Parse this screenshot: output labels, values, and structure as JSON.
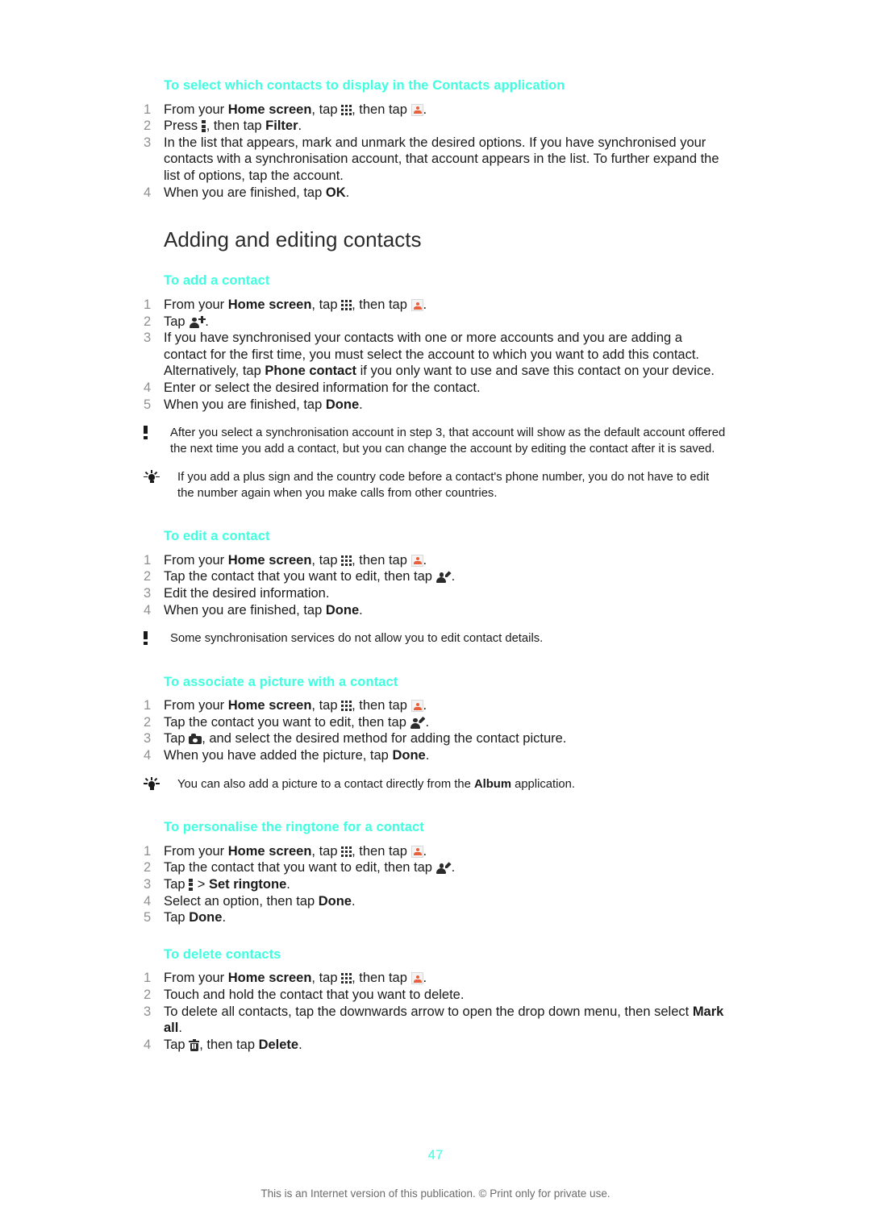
{
  "page": {
    "number": "47",
    "footer_note": "This is an Internet version of this publication. © Print only for private use.",
    "heading_color": "#3fffe0",
    "body_color": "#1a1a1a",
    "step_number_color": "#8f8f8f"
  },
  "proc_filter": {
    "title": "To select which contacts to display in the Contacts application",
    "steps": {
      "s1_a": "From your ",
      "s1_home": "Home screen",
      "s1_b": ", tap ",
      "s1_c": ", then tap ",
      "s1_d": ".",
      "s2_a": "Press ",
      "s2_b": ", then tap ",
      "s2_filter": "Filter",
      "s2_c": ".",
      "s3": "In the list that appears, mark and unmark the desired options. If you have synchronised your contacts with a synchronisation account, that account appears in the list. To further expand the list of options, tap the account.",
      "s4_a": "When you are finished, tap ",
      "s4_ok": "OK",
      "s4_b": "."
    }
  },
  "section": {
    "title": "Adding and editing contacts"
  },
  "proc_add": {
    "title": "To add a contact",
    "steps": {
      "s1_a": "From your ",
      "s1_home": "Home screen",
      "s1_b": ", tap ",
      "s1_c": ", then tap ",
      "s1_d": ".",
      "s2_a": "Tap ",
      "s2_b": ".",
      "s3_a": "If you have synchronised your contacts with one or more accounts and you are adding a contact for the first time, you must select the account to which you want to add this contact. Alternatively, tap ",
      "s3_phone": "Phone contact",
      "s3_b": " if you only want to use and save this contact on your device.",
      "s4": "Enter or select the desired information for the contact.",
      "s5_a": "When you are finished, tap ",
      "s5_done": "Done",
      "s5_b": "."
    },
    "note": "After you select a synchronisation account in step 3, that account will show as the default account offered the next time you add a contact, but you can change the account by editing the contact after it is saved.",
    "tip": "If you add a plus sign and the country code before a contact's phone number, you do not have to edit the number again when you make calls from other countries."
  },
  "proc_edit": {
    "title": "To edit a contact",
    "steps": {
      "s1_a": "From your ",
      "s1_home": "Home screen",
      "s1_b": ", tap ",
      "s1_c": ", then tap ",
      "s1_d": ".",
      "s2_a": "Tap the contact that you want to edit, then tap ",
      "s2_b": ".",
      "s3": "Edit the desired information.",
      "s4_a": "When you are finished, tap ",
      "s4_done": "Done",
      "s4_b": "."
    },
    "note": "Some synchronisation services do not allow you to edit contact details."
  },
  "proc_picture": {
    "title": "To associate a picture with a contact",
    "steps": {
      "s1_a": "From your ",
      "s1_home": "Home screen",
      "s1_b": ", tap ",
      "s1_c": ", then tap ",
      "s1_d": ".",
      "s2_a": "Tap the contact you want to edit, then tap ",
      "s2_b": ".",
      "s3_a": "Tap ",
      "s3_b": ", and select the desired method for adding the contact picture.",
      "s4_a": "When you have added the picture, tap ",
      "s4_done": "Done",
      "s4_b": "."
    },
    "tip_a": "You can also add a picture to a contact directly from the ",
    "tip_album": "Album",
    "tip_b": " application."
  },
  "proc_ringtone": {
    "title": "To personalise the ringtone for a contact",
    "steps": {
      "s1_a": "From your ",
      "s1_home": "Home screen",
      "s1_b": ", tap ",
      "s1_c": ", then tap ",
      "s1_d": ".",
      "s2_a": "Tap the contact that you want to edit, then tap ",
      "s2_b": ".",
      "s3_a": "Tap ",
      "s3_b": " > ",
      "s3_set": "Set ringtone",
      "s3_c": ".",
      "s4_a": "Select an option, then tap ",
      "s4_done": "Done",
      "s4_b": ".",
      "s5_a": "Tap ",
      "s5_done": "Done",
      "s5_b": "."
    }
  },
  "proc_delete": {
    "title": "To delete contacts",
    "steps": {
      "s1_a": "From your ",
      "s1_home": "Home screen",
      "s1_b": ", tap ",
      "s1_c": ", then tap ",
      "s1_d": ".",
      "s2": "Touch and hold the contact that you want to delete.",
      "s3_a": "To delete all contacts, tap the downwards arrow to open the drop down menu, then select ",
      "s3_mark": "Mark all",
      "s3_b": ".",
      "s4_a": "Tap ",
      "s4_b": ", then tap ",
      "s4_delete": "Delete",
      "s4_c": "."
    }
  },
  "icons": {
    "app_grid": "app-grid-icon",
    "contacts_app": "contacts-app-icon",
    "overflow_menu": "overflow-menu-icon",
    "add_contact": "add-contact-icon",
    "edit_contact": "edit-contact-icon",
    "camera": "camera-icon",
    "trash": "trash-icon",
    "note": "exclamation-note-icon",
    "tip": "lightbulb-tip-icon"
  }
}
